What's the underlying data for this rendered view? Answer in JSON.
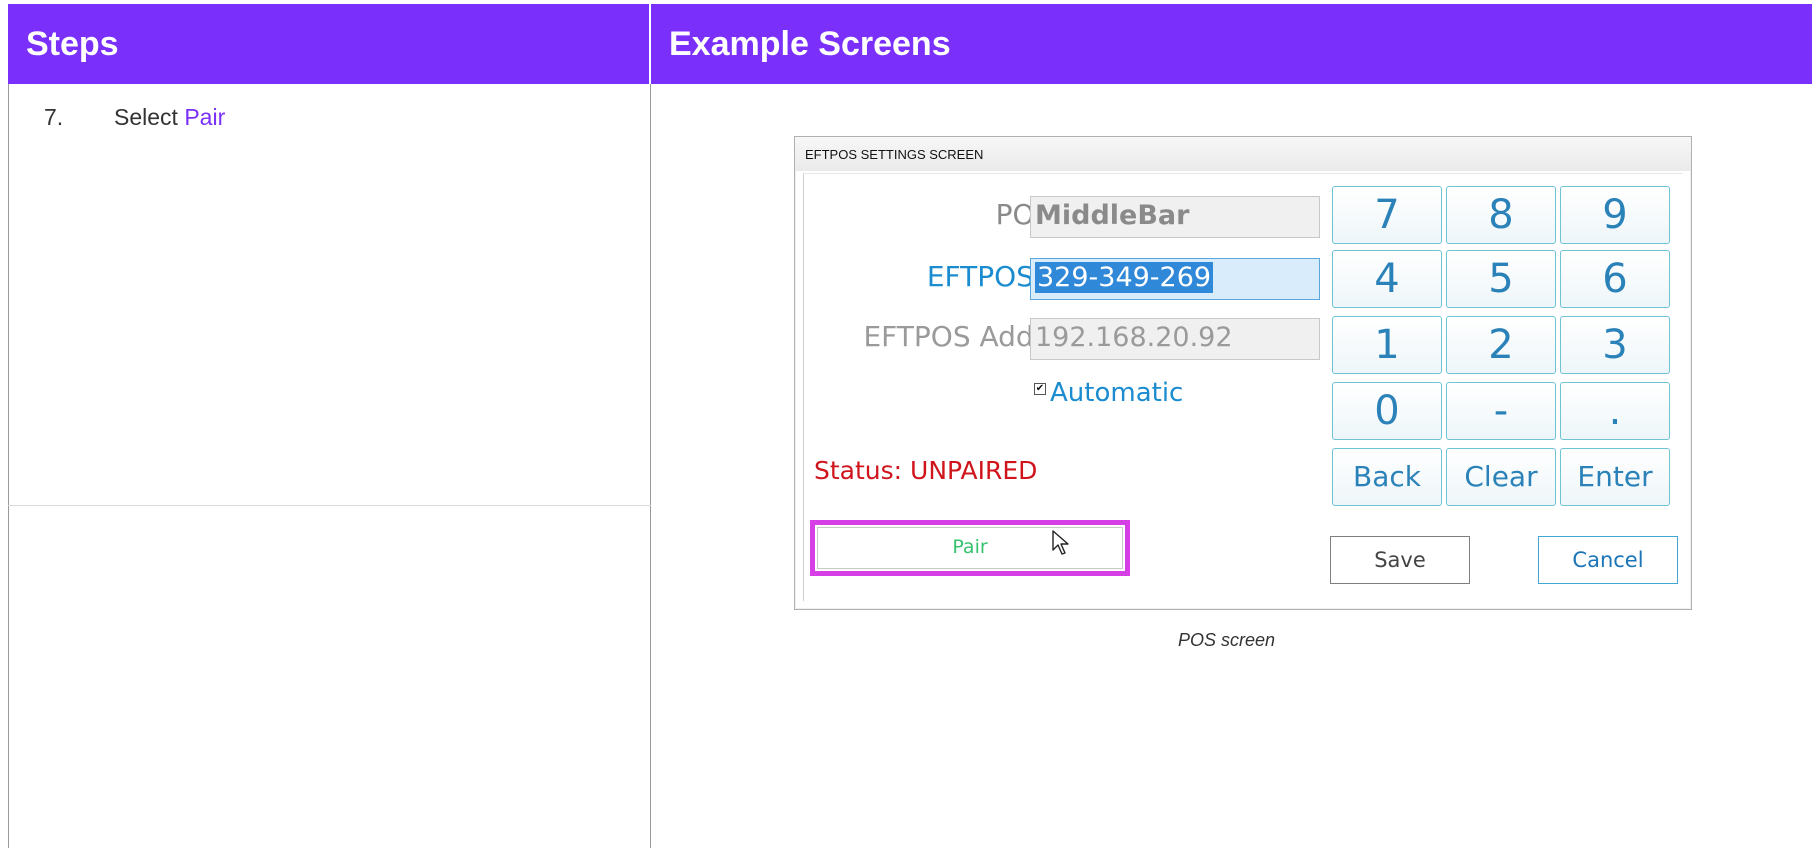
{
  "table": {
    "header_steps": "Steps",
    "header_examples": "Example Screens"
  },
  "step": {
    "number": "7.",
    "text": "Select ",
    "link": "Pair"
  },
  "pos_window": {
    "title": "EFTPOS SETTINGS SCREEN",
    "pos_id_label": "POS ID",
    "pos_id_value": "MiddleBar",
    "sn_label": "EFTPOS S/N",
    "sn_value": "329-349-269",
    "address_label": "EFTPOS Address",
    "address_value": "192.168.20.92",
    "automatic_label": "Automatic",
    "automatic_checked": true,
    "status": "Status: UNPAIRED",
    "pair_label": "Pair",
    "save_label": "Save",
    "cancel_label": "Cancel",
    "keys": [
      "7",
      "8",
      "9",
      "4",
      "5",
      "6",
      "1",
      "2",
      "3",
      "0",
      "-",
      ".",
      "Back",
      "Clear",
      "Enter"
    ],
    "highlight_color": "#d63ee6"
  },
  "caption": "POS screen",
  "colors": {
    "header_bg": "#7a2ffb",
    "link": "#7a2ffb",
    "status_red": "#d0141c"
  }
}
